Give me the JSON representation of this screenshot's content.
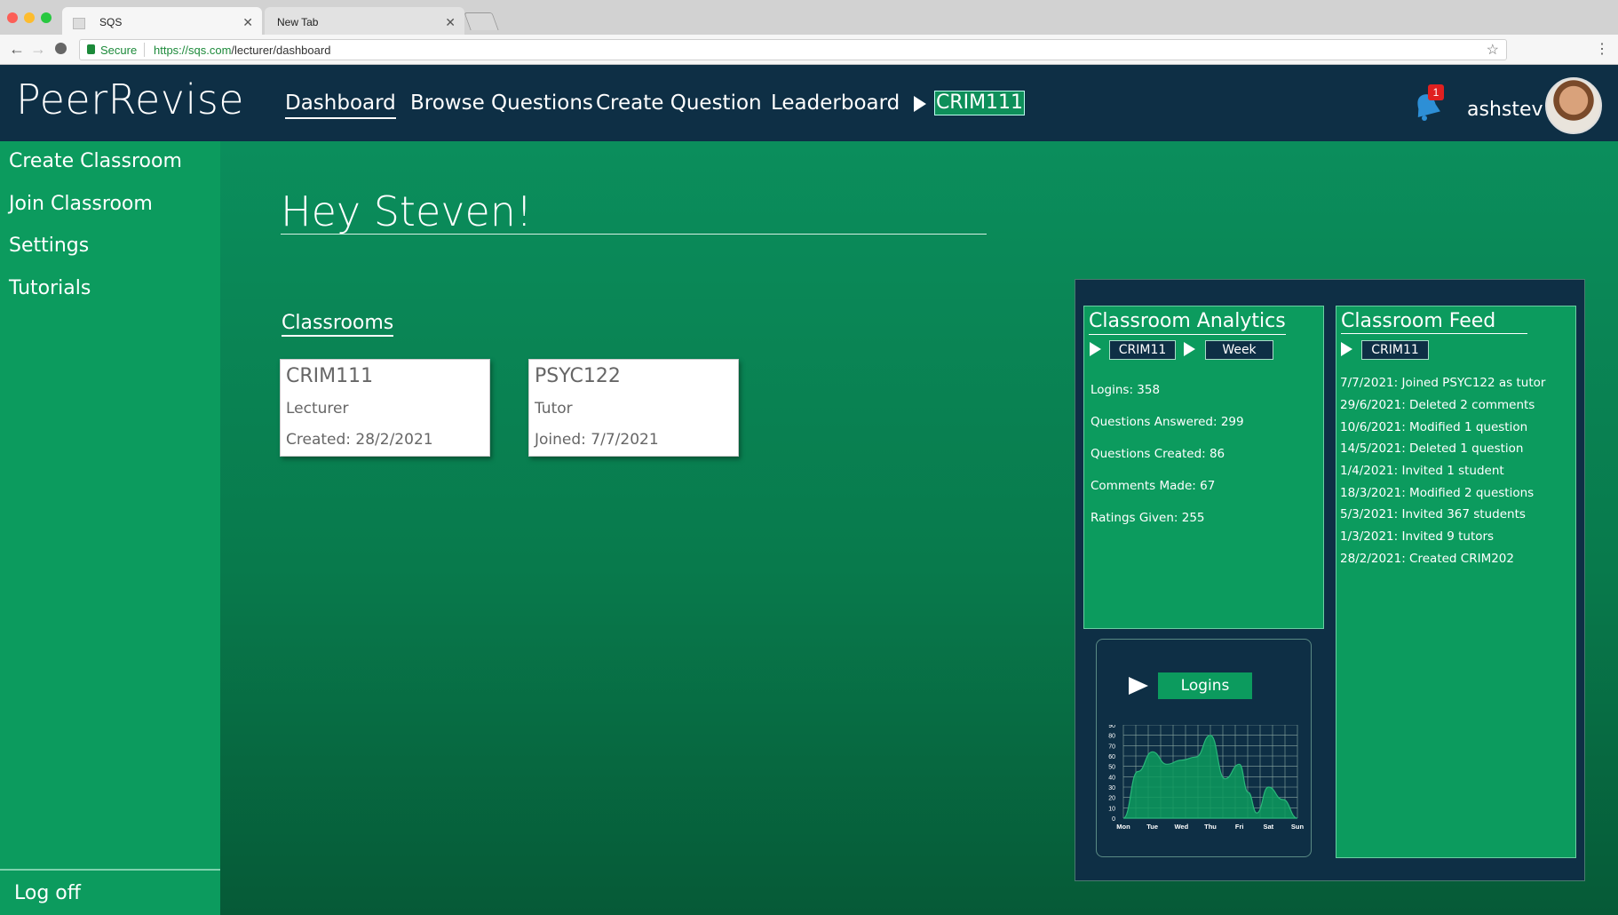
{
  "browser": {
    "tabs": [
      {
        "title": "SQS",
        "active": true
      },
      {
        "title": "New Tab",
        "active": false
      }
    ],
    "secure_label": "Secure",
    "url_host": "https://sqs.com",
    "url_path": "/lecturer/dashboard"
  },
  "header": {
    "logo": "PeerRevise",
    "nav": [
      "Dashboard",
      "Browse Questions",
      "Create Question",
      "Leaderboard"
    ],
    "active_nav": "Dashboard",
    "classroom_selector": "CRIM111",
    "notification_count": "1",
    "username": "ashstev"
  },
  "sidebar": {
    "items": [
      "Create Classroom",
      "Join Classroom",
      "Settings",
      "Tutorials"
    ],
    "logoff": "Log off"
  },
  "main": {
    "greeting": "Hey Steven!",
    "classrooms_title": "Classrooms",
    "cards": [
      {
        "code": "CRIM111",
        "role": "Lecturer",
        "date": "Created: 28/2/2021"
      },
      {
        "code": "PSYC122",
        "role": "Tutor",
        "date": "Joined: 7/7/2021"
      }
    ]
  },
  "analytics": {
    "title": "Classroom Analytics",
    "classroom": "CRIM11",
    "period": "Week",
    "stats": [
      "Logins: 358",
      "Questions Answered: 299",
      "Questions Created: 86",
      "Comments Made: 67",
      "Ratings Given: 255"
    ],
    "chart_metric": "Logins"
  },
  "feed": {
    "title": "Classroom Feed",
    "classroom": "CRIM11",
    "items": [
      "7/7/2021: Joined PSYC122 as tutor",
      "29/6/2021: Deleted 2 comments",
      "10/6/2021: Modified 1 question",
      "14/5/2021: Deleted 1 question",
      "1/4/2021: Invited 1 student",
      "18/3/2021: Modified 2 questions",
      "5/3/2021: Invited 367 students",
      "1/3/2021: Invited 9 tutors",
      "28/2/2021: Created CRIM202"
    ]
  },
  "chart_data": {
    "type": "area",
    "title": "",
    "categories": [
      "Mon",
      "Tue",
      "Wed",
      "Thu",
      "Fri",
      "Sat",
      "Sun"
    ],
    "x": [
      0,
      0.5,
      1,
      1.5,
      2,
      2.5,
      3,
      3.5,
      4,
      4.3,
      4.6,
      5,
      5.5,
      6
    ],
    "y": [
      0,
      45,
      64,
      52,
      56,
      59,
      80,
      38,
      52,
      25,
      5,
      30,
      18,
      0
    ],
    "yticks": [
      0,
      10,
      20,
      30,
      40,
      50,
      60,
      70,
      80,
      90
    ],
    "ylim": [
      0,
      90
    ],
    "grid": true,
    "colors": {
      "fill": "#0c9b5e",
      "stroke": "#2ab77a",
      "grid": "#8aa8a0",
      "text": "#ffffff"
    }
  }
}
